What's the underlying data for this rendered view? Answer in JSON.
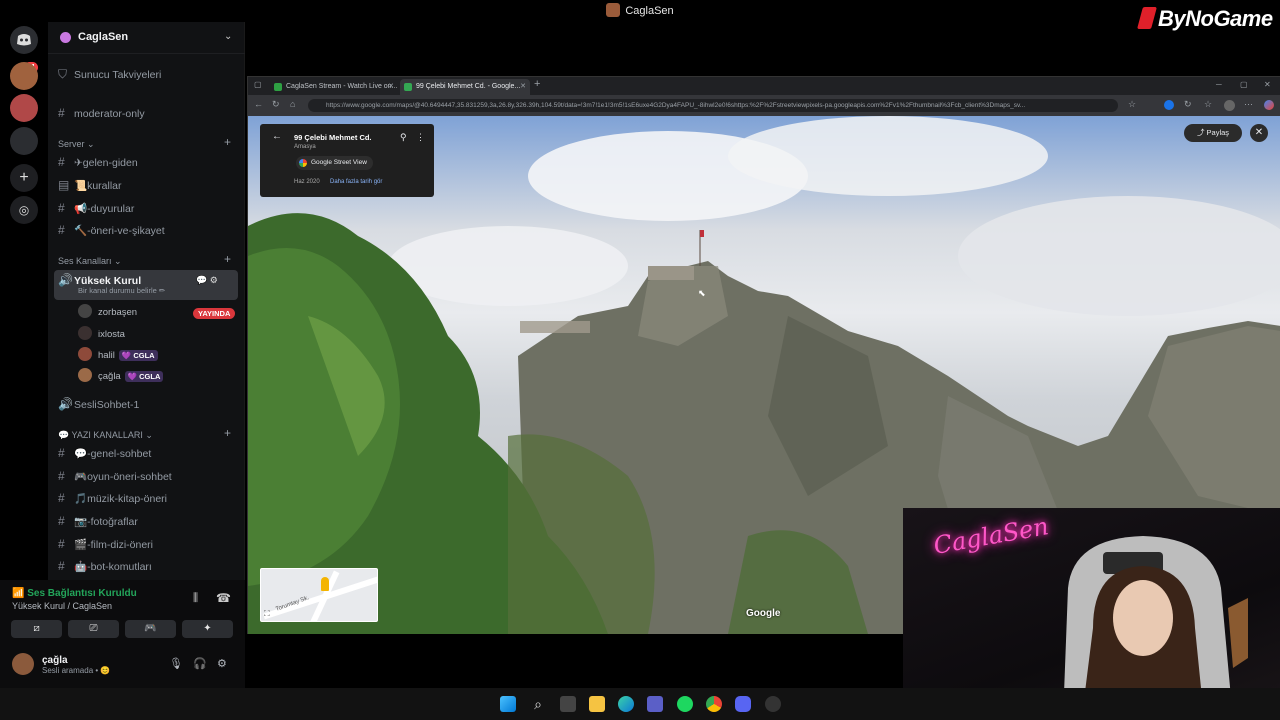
{
  "window": {
    "title": "CaglaSen"
  },
  "watermark": "ByNoGame",
  "rail": {
    "badge": "11"
  },
  "server": {
    "name": "CaglaSen",
    "top_channel": "Sunucu Takviyeleri",
    "moderator": "moderator-only",
    "categories": {
      "server": "Server",
      "voice": "Ses Kanalları",
      "text": "💬 YAZI KANALLARI"
    },
    "server_channels": [
      "✈gelen-giden",
      "📜kurallar",
      "📢-duyurular",
      "🔨-öneri-ve-şikayet"
    ],
    "voice_channel": {
      "name": "Yüksek Kurul",
      "status": "Bir kanal durumu belirle ✏"
    },
    "voice_users": [
      {
        "name": "zorbaşen",
        "live": "YAYINDA"
      },
      {
        "name": "ixlosta"
      },
      {
        "name": "halil",
        "tag": "💜 CGLA"
      },
      {
        "name": "çağla",
        "tag": "💜 CGLA"
      }
    ],
    "voice_channel_2": "SesliSohbet-1",
    "text_channels": [
      "💬-genel-sohbet",
      "🎮oyun-öneri-sohbet",
      "🎵müzik-kitap-öneri",
      "📷-fotoğraflar",
      "🎬-film-dizi-öneri",
      "🤖-bot-komutları"
    ]
  },
  "voice_panel": {
    "status": "Ses Bağlantısı Kuruldu",
    "sub": "Yüksek Kurul / CaglaSen",
    "user": "çağla",
    "user_status": "Sesli aramada • 😊"
  },
  "browser": {
    "tabs": [
      {
        "label": "CaglaSen Stream - Watch Live on..."
      },
      {
        "label": "99 Çelebi Mehmet Cd. - Google..."
      }
    ],
    "url": "https://www.google.com/maps/@40.6494447,35.831259,3a,26.8y,326.39h,104.59t/data=!3m7!1e1!3m5!1sE6uxe4G2Dya4FAPU_-8ihwl2e0!6shttps:%2F%2Fstreetviewpixels-pa.googleapis.com%2Fv1%2Fthumbnail%3Fcb_client%3Dmaps_sv..."
  },
  "streetview": {
    "address": "99 Çelebi Mehmet Cd.",
    "city": "Amasya",
    "source": "Google Street View",
    "date": "Haz 2020",
    "more_dates": "Daha fazla tarih gör",
    "share": "Paylaş",
    "minimap_label": "Torumtay Sk.",
    "brand": "Google"
  },
  "webcam": {
    "neon_text": "CaglaSen"
  },
  "colors": {
    "discord_green": "#23a55a",
    "live_red": "#da373c",
    "accent_pink": "#ff57c8"
  }
}
